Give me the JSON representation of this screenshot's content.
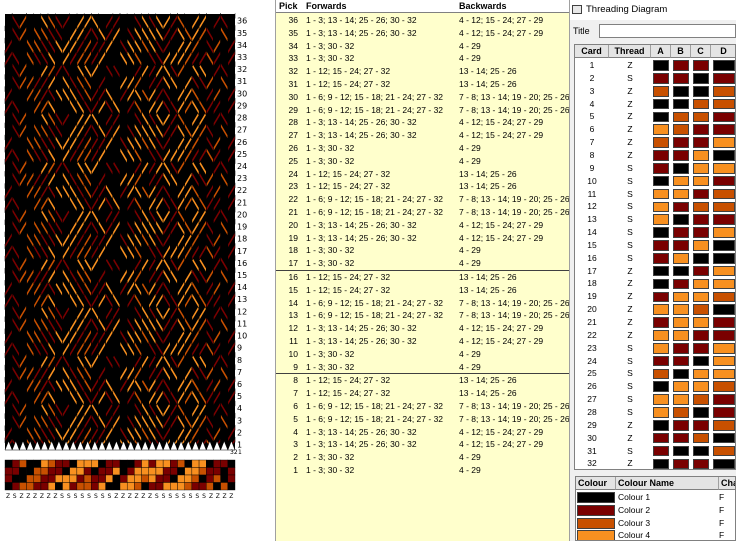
{
  "window": {
    "title": "Threading Diagram"
  },
  "colors": {
    "c1": "#000000",
    "c2": "#7a0000",
    "c3": "#c85000",
    "c4": "#f89020"
  },
  "pattern": {
    "pick_numbers": [
      "36",
      "35",
      "34",
      "33",
      "32",
      "31",
      "30",
      "29",
      "28",
      "27",
      "26",
      "25",
      "24",
      "23",
      "22",
      "21",
      "20",
      "19",
      "18",
      "17",
      "16",
      "15",
      "14",
      "13",
      "12",
      "11",
      "10",
      "9",
      "8",
      "7",
      "6",
      "5",
      "4",
      "3",
      "2",
      "1"
    ],
    "card_directions": "ZSZZZZZZSSSSSSSSZZZZZZSSSSSSSSZZZZ",
    "bottom_numbers": [
      "32",
      "1"
    ]
  },
  "pick_table": {
    "headers": {
      "pick": "Pick",
      "forwards": "Forwards",
      "backwards": "Backwards"
    },
    "rows": [
      {
        "pick": "36",
        "forwards": "1 - 3; 13 - 14; 25 - 26; 30 - 32",
        "backwards": "4 - 12; 15 - 24; 27 - 29"
      },
      {
        "pick": "35",
        "forwards": "1 - 3; 13 - 14; 25 - 26; 30 - 32",
        "backwards": "4 - 12; 15 - 24; 27 - 29"
      },
      {
        "pick": "34",
        "forwards": "1 - 3; 30 - 32",
        "backwards": "4 - 29"
      },
      {
        "pick": "33",
        "forwards": "1 - 3; 30 - 32",
        "backwards": "4 - 29"
      },
      {
        "pick": "32",
        "forwards": "1 - 12; 15 - 24; 27 - 32",
        "backwards": "13 - 14; 25 - 26"
      },
      {
        "pick": "31",
        "forwards": "1 - 12; 15 - 24; 27 - 32",
        "backwards": "13 - 14; 25 - 26"
      },
      {
        "pick": "30",
        "forwards": "1 - 6; 9 - 12; 15 - 18; 21 - 24; 27 - 32",
        "backwards": "7 - 8; 13 - 14; 19 - 20; 25 - 26"
      },
      {
        "pick": "29",
        "forwards": "1 - 6; 9 - 12; 15 - 18; 21 - 24; 27 - 32",
        "backwards": "7 - 8; 13 - 14; 19 - 20; 25 - 26"
      },
      {
        "pick": "28",
        "forwards": "1 - 3; 13 - 14; 25 - 26; 30 - 32",
        "backwards": "4 - 12; 15 - 24; 27 - 29"
      },
      {
        "pick": "27",
        "forwards": "1 - 3; 13 - 14; 25 - 26; 30 - 32",
        "backwards": "4 - 12; 15 - 24; 27 - 29"
      },
      {
        "pick": "26",
        "forwards": "1 - 3; 30 - 32",
        "backwards": "4 - 29"
      },
      {
        "pick": "25",
        "forwards": "1 - 3; 30 - 32",
        "backwards": "4 - 29"
      },
      {
        "pick": "24",
        "forwards": "1 - 12; 15 - 24; 27 - 32",
        "backwards": "13 - 14; 25 - 26"
      },
      {
        "pick": "23",
        "forwards": "1 - 12; 15 - 24; 27 - 32",
        "backwards": "13 - 14; 25 - 26"
      },
      {
        "pick": "22",
        "forwards": "1 - 6; 9 - 12; 15 - 18; 21 - 24; 27 - 32",
        "backwards": "7 - 8; 13 - 14; 19 - 20; 25 - 26"
      },
      {
        "pick": "21",
        "forwards": "1 - 6; 9 - 12; 15 - 18; 21 - 24; 27 - 32",
        "backwards": "7 - 8; 13 - 14; 19 - 20; 25 - 26"
      },
      {
        "pick": "20",
        "forwards": "1 - 3; 13 - 14; 25 - 26; 30 - 32",
        "backwards": "4 - 12; 15 - 24; 27 - 29"
      },
      {
        "pick": "19",
        "forwards": "1 - 3; 13 - 14; 25 - 26; 30 - 32",
        "backwards": "4 - 12; 15 - 24; 27 - 29"
      },
      {
        "pick": "18",
        "forwards": "1 - 3; 30 - 32",
        "backwards": "4 - 29"
      },
      {
        "pick": "17",
        "forwards": "1 - 3; 30 - 32",
        "backwards": "4 - 29"
      },
      {
        "pick": "16",
        "forwards": "1 - 12; 15 - 24; 27 - 32",
        "backwards": "13 - 14; 25 - 26"
      },
      {
        "pick": "15",
        "forwards": "1 - 12; 15 - 24; 27 - 32",
        "backwards": "13 - 14; 25 - 26"
      },
      {
        "pick": "14",
        "forwards": "1 - 6; 9 - 12; 15 - 18; 21 - 24; 27 - 32",
        "backwards": "7 - 8; 13 - 14; 19 - 20; 25 - 26"
      },
      {
        "pick": "13",
        "forwards": "1 - 6; 9 - 12; 15 - 18; 21 - 24; 27 - 32",
        "backwards": "7 - 8; 13 - 14; 19 - 20; 25 - 26"
      },
      {
        "pick": "12",
        "forwards": "1 - 3; 13 - 14; 25 - 26; 30 - 32",
        "backwards": "4 - 12; 15 - 24; 27 - 29"
      },
      {
        "pick": "11",
        "forwards": "1 - 3; 13 - 14; 25 - 26; 30 - 32",
        "backwards": "4 - 12; 15 - 24; 27 - 29"
      },
      {
        "pick": "10",
        "forwards": "1 - 3; 30 - 32",
        "backwards": "4 - 29"
      },
      {
        "pick": "9",
        "forwards": "1 - 3; 30 - 32",
        "backwards": "4 - 29"
      },
      {
        "pick": "8",
        "forwards": "1 - 12; 15 - 24; 27 - 32",
        "backwards": "13 - 14; 25 - 26"
      },
      {
        "pick": "7",
        "forwards": "1 - 12; 15 - 24; 27 - 32",
        "backwards": "13 - 14; 25 - 26"
      },
      {
        "pick": "6",
        "forwards": "1 - 6; 9 - 12; 15 - 18; 21 - 24; 27 - 32",
        "backwards": "7 - 8; 13 - 14; 19 - 20; 25 - 26"
      },
      {
        "pick": "5",
        "forwards": "1 - 6; 9 - 12; 15 - 18; 21 - 24; 27 - 32",
        "backwards": "7 - 8; 13 - 14; 19 - 20; 25 - 26"
      },
      {
        "pick": "4",
        "forwards": "1 - 3; 13 - 14; 25 - 26; 30 - 32",
        "backwards": "4 - 12; 15 - 24; 27 - 29"
      },
      {
        "pick": "3",
        "forwards": "1 - 3; 13 - 14; 25 - 26; 30 - 32",
        "backwards": "4 - 12; 15 - 24; 27 - 29"
      },
      {
        "pick": "2",
        "forwards": "1 - 3; 30 - 32",
        "backwards": "4 - 29"
      },
      {
        "pick": "1",
        "forwards": "1 - 3; 30 - 32",
        "backwards": "4 - 29"
      }
    ]
  },
  "threading": {
    "title_label": "Title",
    "title_value": "",
    "headers": {
      "card": "Card",
      "thread": "Thread",
      "holes": [
        "A",
        "B",
        "C",
        "D"
      ]
    },
    "cards": [
      {
        "card": "1",
        "thread": "Z",
        "holes": [
          1,
          2,
          2,
          1
        ]
      },
      {
        "card": "2",
        "thread": "S",
        "holes": [
          2,
          2,
          1,
          2
        ]
      },
      {
        "card": "3",
        "thread": "Z",
        "holes": [
          3,
          1,
          1,
          3
        ]
      },
      {
        "card": "4",
        "thread": "Z",
        "holes": [
          1,
          1,
          3,
          3
        ]
      },
      {
        "card": "5",
        "thread": "Z",
        "holes": [
          1,
          3,
          3,
          2
        ]
      },
      {
        "card": "6",
        "thread": "Z",
        "holes": [
          4,
          3,
          2,
          2
        ]
      },
      {
        "card": "7",
        "thread": "Z",
        "holes": [
          3,
          2,
          2,
          4
        ]
      },
      {
        "card": "8",
        "thread": "Z",
        "holes": [
          2,
          2,
          4,
          1
        ]
      },
      {
        "card": "9",
        "thread": "S",
        "holes": [
          2,
          1,
          4,
          4
        ]
      },
      {
        "card": "10",
        "thread": "S",
        "holes": [
          1,
          4,
          4,
          2
        ]
      },
      {
        "card": "11",
        "thread": "S",
        "holes": [
          4,
          4,
          2,
          3
        ]
      },
      {
        "card": "12",
        "thread": "S",
        "holes": [
          4,
          2,
          3,
          3
        ]
      },
      {
        "card": "13",
        "thread": "S",
        "holes": [
          4,
          1,
          2,
          2
        ]
      },
      {
        "card": "14",
        "thread": "S",
        "holes": [
          1,
          2,
          2,
          4
        ]
      },
      {
        "card": "15",
        "thread": "S",
        "holes": [
          2,
          2,
          4,
          1
        ]
      },
      {
        "card": "16",
        "thread": "S",
        "holes": [
          2,
          4,
          1,
          1
        ]
      },
      {
        "card": "17",
        "thread": "Z",
        "holes": [
          1,
          1,
          2,
          4
        ]
      },
      {
        "card": "18",
        "thread": "Z",
        "holes": [
          1,
          2,
          4,
          4
        ]
      },
      {
        "card": "19",
        "thread": "Z",
        "holes": [
          2,
          4,
          4,
          3
        ]
      },
      {
        "card": "20",
        "thread": "Z",
        "holes": [
          4,
          4,
          3,
          1
        ]
      },
      {
        "card": "21",
        "thread": "Z",
        "holes": [
          2,
          4,
          4,
          2
        ]
      },
      {
        "card": "22",
        "thread": "Z",
        "holes": [
          4,
          4,
          2,
          2
        ]
      },
      {
        "card": "23",
        "thread": "S",
        "holes": [
          4,
          2,
          2,
          4
        ]
      },
      {
        "card": "24",
        "thread": "S",
        "holes": [
          2,
          2,
          1,
          4
        ]
      },
      {
        "card": "25",
        "thread": "S",
        "holes": [
          3,
          1,
          4,
          4
        ]
      },
      {
        "card": "26",
        "thread": "S",
        "holes": [
          1,
          4,
          4,
          3
        ]
      },
      {
        "card": "27",
        "thread": "S",
        "holes": [
          4,
          4,
          3,
          2
        ]
      },
      {
        "card": "28",
        "thread": "S",
        "holes": [
          4,
          3,
          1,
          2
        ]
      },
      {
        "card": "29",
        "thread": "Z",
        "holes": [
          1,
          2,
          2,
          3
        ]
      },
      {
        "card": "30",
        "thread": "Z",
        "holes": [
          2,
          2,
          3,
          1
        ]
      },
      {
        "card": "31",
        "thread": "S",
        "holes": [
          2,
          1,
          1,
          3
        ]
      },
      {
        "card": "32",
        "thread": "Z",
        "holes": [
          1,
          2,
          2,
          1
        ]
      }
    ]
  },
  "colour_table": {
    "headers": {
      "colour": "Colour",
      "name": "Colour Name",
      "character": "Character"
    },
    "rows": [
      {
        "color": "#000000",
        "name": "Colour 1",
        "character": "F"
      },
      {
        "color": "#7a0000",
        "name": "Colour 2",
        "character": "F"
      },
      {
        "color": "#c85000",
        "name": "Colour 3",
        "character": "F"
      },
      {
        "color": "#f89020",
        "name": "Colour 4",
        "character": "F"
      }
    ]
  }
}
